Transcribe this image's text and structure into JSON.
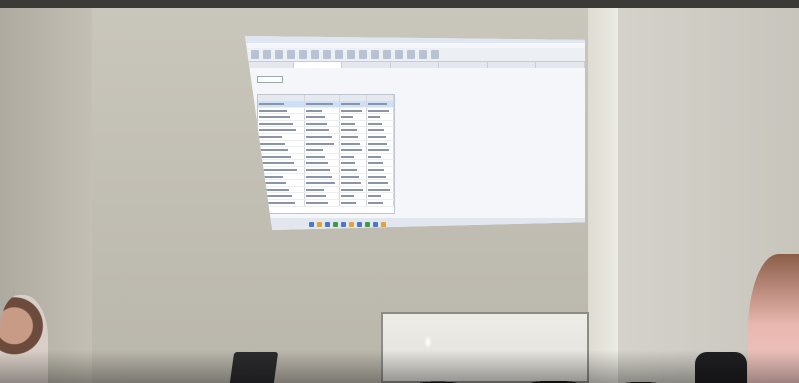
{
  "scene": {
    "description_hidden": "",
    "colors": {
      "wall": "#c9c6bb",
      "projection": "#f4f6fa",
      "whiteboard": "#eceae4"
    }
  },
  "projected_ui": {
    "tabs": [
      "",
      "",
      "",
      "",
      "",
      "",
      ""
    ],
    "rows": 16,
    "taskbar_icons": [
      "app-icon",
      "app-icon",
      "app-icon",
      "app-icon",
      "app-icon",
      "app-icon",
      "app-icon",
      "app-icon",
      "app-icon",
      "app-icon"
    ]
  }
}
